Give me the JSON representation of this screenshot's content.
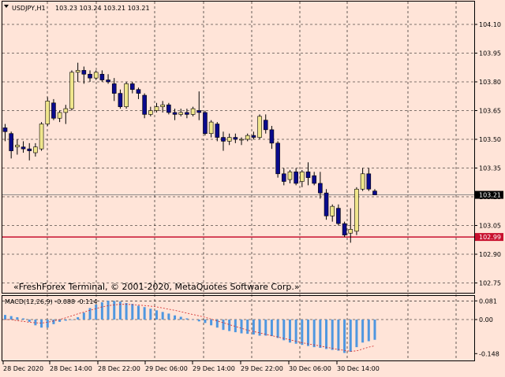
{
  "header": {
    "symbol": "USDJPY,H1",
    "ohlc": "103.23 103.24 103.21 103.21"
  },
  "copyright": "«FreshForex Terminal, © 2001-2020, MetaQuotes Software Corp.»",
  "price_axis": {
    "ticks": [
      "104.10",
      "103.95",
      "103.80",
      "103.65",
      "103.50",
      "103.35",
      "103.20",
      "103.05",
      "102.90",
      "102.75"
    ],
    "current_price_label": "103.21",
    "level_line_label": "102.99"
  },
  "macd": {
    "label": "MACD(12,26,9) -0.088 -0.114",
    "ticks": [
      "0.081",
      "0.00",
      "-0.148"
    ]
  },
  "time_axis": {
    "labels": [
      "28 Dec 2020",
      "28 Dec 14:00",
      "28 Dec 22:00",
      "29 Dec 06:00",
      "29 Dec 14:00",
      "29 Dec 22:00",
      "30 Dec 06:00",
      "30 Dec 14:00"
    ]
  },
  "colors": {
    "background": "#ffe4d8",
    "bull_candle": "#f0e68c",
    "bear_candle": "#0a0a8c",
    "level_line": "#c8102e",
    "macd_histogram": "#4f97e0",
    "macd_signal": "#d02020"
  },
  "chart_data": {
    "type": "candlestick",
    "symbol": "USDJPY",
    "timeframe": "H1",
    "ylim": [
      102.72,
      104.14
    ],
    "candles": [
      {
        "o": 103.56,
        "h": 103.58,
        "l": 103.49,
        "c": 103.54
      },
      {
        "o": 103.53,
        "h": 103.54,
        "l": 103.4,
        "c": 103.44
      },
      {
        "o": 103.46,
        "h": 103.5,
        "l": 103.42,
        "c": 103.47
      },
      {
        "o": 103.46,
        "h": 103.49,
        "l": 103.43,
        "c": 103.45
      },
      {
        "o": 103.45,
        "h": 103.48,
        "l": 103.39,
        "c": 103.44
      },
      {
        "o": 103.43,
        "h": 103.48,
        "l": 103.41,
        "c": 103.46
      },
      {
        "o": 103.45,
        "h": 103.59,
        "l": 103.44,
        "c": 103.58
      },
      {
        "o": 103.58,
        "h": 103.72,
        "l": 103.57,
        "c": 103.7
      },
      {
        "o": 103.69,
        "h": 103.71,
        "l": 103.6,
        "c": 103.61
      },
      {
        "o": 103.61,
        "h": 103.65,
        "l": 103.59,
        "c": 103.64
      },
      {
        "o": 103.64,
        "h": 103.68,
        "l": 103.58,
        "c": 103.66
      },
      {
        "o": 103.66,
        "h": 103.86,
        "l": 103.65,
        "c": 103.85
      },
      {
        "o": 103.85,
        "h": 103.9,
        "l": 103.8,
        "c": 103.86
      },
      {
        "o": 103.86,
        "h": 103.88,
        "l": 103.79,
        "c": 103.84
      },
      {
        "o": 103.84,
        "h": 103.86,
        "l": 103.8,
        "c": 103.82
      },
      {
        "o": 103.82,
        "h": 103.86,
        "l": 103.81,
        "c": 103.85
      },
      {
        "o": 103.84,
        "h": 103.86,
        "l": 103.8,
        "c": 103.81
      },
      {
        "o": 103.81,
        "h": 103.84,
        "l": 103.79,
        "c": 103.8
      },
      {
        "o": 103.79,
        "h": 103.82,
        "l": 103.7,
        "c": 103.74
      },
      {
        "o": 103.74,
        "h": 103.76,
        "l": 103.66,
        "c": 103.67
      },
      {
        "o": 103.67,
        "h": 103.8,
        "l": 103.66,
        "c": 103.79
      },
      {
        "o": 103.79,
        "h": 103.8,
        "l": 103.74,
        "c": 103.76
      },
      {
        "o": 103.76,
        "h": 103.77,
        "l": 103.71,
        "c": 103.74
      },
      {
        "o": 103.73,
        "h": 103.74,
        "l": 103.61,
        "c": 103.63
      },
      {
        "o": 103.63,
        "h": 103.67,
        "l": 103.62,
        "c": 103.65
      },
      {
        "o": 103.65,
        "h": 103.69,
        "l": 103.64,
        "c": 103.67
      },
      {
        "o": 103.67,
        "h": 103.7,
        "l": 103.64,
        "c": 103.68
      },
      {
        "o": 103.68,
        "h": 103.69,
        "l": 103.63,
        "c": 103.64
      },
      {
        "o": 103.64,
        "h": 103.66,
        "l": 103.6,
        "c": 103.63
      },
      {
        "o": 103.63,
        "h": 103.66,
        "l": 103.62,
        "c": 103.64
      },
      {
        "o": 103.64,
        "h": 103.66,
        "l": 103.61,
        "c": 103.63
      },
      {
        "o": 103.63,
        "h": 103.67,
        "l": 103.62,
        "c": 103.66
      },
      {
        "o": 103.65,
        "h": 103.75,
        "l": 103.6,
        "c": 103.64
      },
      {
        "o": 103.64,
        "h": 103.65,
        "l": 103.52,
        "c": 103.53
      },
      {
        "o": 103.53,
        "h": 103.6,
        "l": 103.51,
        "c": 103.59
      },
      {
        "o": 103.58,
        "h": 103.59,
        "l": 103.49,
        "c": 103.51
      },
      {
        "o": 103.51,
        "h": 103.54,
        "l": 103.44,
        "c": 103.49
      },
      {
        "o": 103.49,
        "h": 103.53,
        "l": 103.47,
        "c": 103.51
      },
      {
        "o": 103.51,
        "h": 103.53,
        "l": 103.48,
        "c": 103.5
      },
      {
        "o": 103.5,
        "h": 103.51,
        "l": 103.47,
        "c": 103.5
      },
      {
        "o": 103.5,
        "h": 103.53,
        "l": 103.49,
        "c": 103.52
      },
      {
        "o": 103.52,
        "h": 103.54,
        "l": 103.5,
        "c": 103.51
      },
      {
        "o": 103.51,
        "h": 103.63,
        "l": 103.5,
        "c": 103.62
      },
      {
        "o": 103.6,
        "h": 103.63,
        "l": 103.53,
        "c": 103.55
      },
      {
        "o": 103.55,
        "h": 103.57,
        "l": 103.45,
        "c": 103.48
      },
      {
        "o": 103.48,
        "h": 103.49,
        "l": 103.3,
        "c": 103.32
      },
      {
        "o": 103.32,
        "h": 103.35,
        "l": 103.26,
        "c": 103.28
      },
      {
        "o": 103.29,
        "h": 103.34,
        "l": 103.27,
        "c": 103.33
      },
      {
        "o": 103.33,
        "h": 103.35,
        "l": 103.26,
        "c": 103.27
      },
      {
        "o": 103.28,
        "h": 103.34,
        "l": 103.25,
        "c": 103.33
      },
      {
        "o": 103.33,
        "h": 103.38,
        "l": 103.26,
        "c": 103.3
      },
      {
        "o": 103.31,
        "h": 103.33,
        "l": 103.26,
        "c": 103.27
      },
      {
        "o": 103.27,
        "h": 103.33,
        "l": 103.19,
        "c": 103.22
      },
      {
        "o": 103.22,
        "h": 103.24,
        "l": 103.08,
        "c": 103.1
      },
      {
        "o": 103.1,
        "h": 103.16,
        "l": 103.07,
        "c": 103.15
      },
      {
        "o": 103.14,
        "h": 103.16,
        "l": 103.05,
        "c": 103.06
      },
      {
        "o": 103.06,
        "h": 103.07,
        "l": 102.99,
        "c": 103.0
      },
      {
        "o": 103.01,
        "h": 103.14,
        "l": 102.96,
        "c": 103.03
      },
      {
        "o": 103.02,
        "h": 103.25,
        "l": 103.0,
        "c": 103.24
      },
      {
        "o": 103.24,
        "h": 103.35,
        "l": 103.23,
        "c": 103.32
      },
      {
        "o": 103.32,
        "h": 103.35,
        "l": 103.23,
        "c": 103.24
      },
      {
        "o": 103.23,
        "h": 103.24,
        "l": 103.21,
        "c": 103.21
      }
    ],
    "macd_histogram": [
      0.02,
      0.015,
      0.01,
      0.005,
      -0.01,
      -0.025,
      -0.035,
      -0.035,
      -0.02,
      -0.01,
      -0.005,
      0.0,
      0.01,
      0.03,
      0.05,
      0.065,
      0.075,
      0.082,
      0.081,
      0.078,
      0.072,
      0.068,
      0.06,
      0.054,
      0.047,
      0.04,
      0.033,
      0.026,
      0.018,
      0.012,
      0.005,
      0.0,
      -0.008,
      -0.015,
      -0.025,
      -0.035,
      -0.045,
      -0.05,
      -0.055,
      -0.06,
      -0.062,
      -0.065,
      -0.07,
      -0.07,
      -0.072,
      -0.08,
      -0.09,
      -0.1,
      -0.105,
      -0.11,
      -0.115,
      -0.12,
      -0.123,
      -0.128,
      -0.132,
      -0.135,
      -0.145,
      -0.14,
      -0.12,
      -0.1,
      -0.094,
      -0.088
    ],
    "macd_signal": [
      0.0,
      0.0,
      -0.005,
      -0.008,
      -0.012,
      -0.014,
      -0.015,
      -0.012,
      -0.006,
      0.0,
      0.008,
      0.016,
      0.025,
      0.032,
      0.04,
      0.048,
      0.055,
      0.06,
      0.064,
      0.066,
      0.066,
      0.065,
      0.063,
      0.061,
      0.058,
      0.055,
      0.05,
      0.045,
      0.04,
      0.034,
      0.028,
      0.022,
      0.016,
      0.01,
      0.002,
      -0.006,
      -0.014,
      -0.022,
      -0.03,
      -0.038,
      -0.046,
      -0.052,
      -0.058,
      -0.064,
      -0.07,
      -0.076,
      -0.082,
      -0.088,
      -0.094,
      -0.1,
      -0.106,
      -0.11,
      -0.115,
      -0.12,
      -0.125,
      -0.13,
      -0.134,
      -0.138,
      -0.136,
      -0.128,
      -0.12,
      -0.114
    ],
    "macd_ylim": [
      -0.148,
      0.081
    ],
    "level_line": 102.99,
    "current_price": 103.21
  }
}
